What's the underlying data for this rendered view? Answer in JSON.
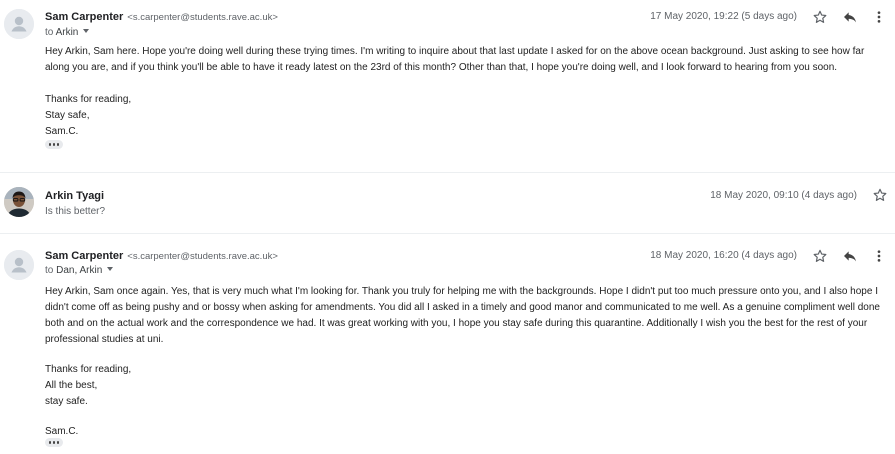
{
  "messages": [
    {
      "sender": "Sam Carpenter",
      "email": "<s.carpenter@students.rave.ac.uk>",
      "to_prefix": "to",
      "to_names": "Arkin",
      "date": "17 May 2020, 19:22 (5 days ago)",
      "body": [
        "Hey Arkin, Sam here. Hope you're doing well during these trying times. I'm writing to inquire about that last update I asked for on the above ocean background. Just asking to see how far along you are, and if you think you'll be able to have it ready latest on the 23rd of this month? Other than that, I hope you're doing well, and I look forward to hearing from you soon.",
        "Thanks for reading,",
        "Stay safe,",
        "Sam.C."
      ]
    },
    {
      "sender": "Arkin Tyagi",
      "date": "18 May 2020, 09:10 (4 days ago)",
      "snippet": "Is this better?"
    },
    {
      "sender": "Sam Carpenter",
      "email": "<s.carpenter@students.rave.ac.uk>",
      "to_prefix": "to",
      "to_names": "Dan, Arkin",
      "date": "18 May 2020, 16:20 (4 days ago)",
      "body": [
        "Hey Arkin, Sam once again. Yes, that is very much what I'm looking for. Thank you truly for helping me with the backgrounds. Hope I didn't put too much pressure onto you, and I also hope I didn't come off as being pushy and or bossy when asking for amendments. You did all I asked in a timely and good manor and communicated to me well. As a genuine compliment well done both and on the actual work and the correspondence we had. It was great working with you, I hope you stay safe during this quarantine. Additionally I wish you the best for the rest of your professional studies at uni.",
        "Thanks for reading,",
        "All the best,",
        "stay safe.",
        "Sam.C."
      ]
    }
  ],
  "icons": {
    "star": "star-icon",
    "reply": "reply-icon",
    "more": "more-vert-icon",
    "avatar_default": "person-avatar-icon",
    "expand": "more-horiz-icon"
  }
}
